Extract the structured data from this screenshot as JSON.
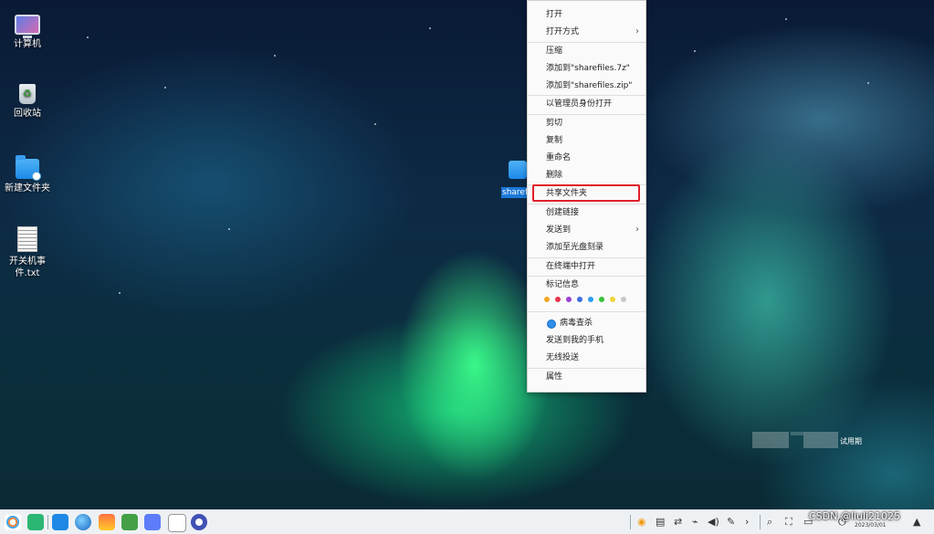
{
  "desktop": {
    "icons": [
      {
        "label": "计算机",
        "icon": "computer-icon"
      },
      {
        "label": "回收站",
        "icon": "trash-icon"
      },
      {
        "label": "新建文件夹",
        "icon": "folder-icon"
      },
      {
        "label": "开关机事件.txt",
        "icon": "text-file-icon"
      }
    ],
    "selected_item": {
      "label": "sharefiles",
      "icon": "folder-icon"
    }
  },
  "context_menu": {
    "items": [
      {
        "label": "打开",
        "submenu": false
      },
      {
        "label": "打开方式",
        "submenu": true
      },
      {
        "label": "压缩",
        "submenu": false
      },
      {
        "label": "添加到\"sharefiles.7z\"",
        "submenu": false
      },
      {
        "label": "添加到\"sharefiles.zip\"",
        "submenu": false
      },
      {
        "label": "以管理员身份打开",
        "submenu": false
      },
      {
        "label": "剪切",
        "submenu": false
      },
      {
        "label": "复制",
        "submenu": false
      },
      {
        "label": "重命名",
        "submenu": false
      },
      {
        "label": "删除",
        "submenu": false
      },
      {
        "label": "共享文件夹",
        "submenu": false,
        "highlighted": true
      },
      {
        "label": "创建链接",
        "submenu": false
      },
      {
        "label": "发送到",
        "submenu": true
      },
      {
        "label": "添加至光盘刻录",
        "submenu": false
      },
      {
        "label": "在终端中打开",
        "submenu": false
      },
      {
        "label": "标记信息",
        "submenu": false
      },
      {
        "label": "病毒查杀",
        "submenu": false,
        "icon": "shield-icon"
      },
      {
        "label": "发送到我的手机",
        "submenu": false
      },
      {
        "label": "无线投送",
        "submenu": false
      },
      {
        "label": "属性",
        "submenu": false
      }
    ],
    "submenu_arrow": "›",
    "tag_colors": [
      "#f5a623",
      "#e8334a",
      "#9b3fd6",
      "#3b6fe0",
      "#2a9df4",
      "#39c239",
      "#f2d43a",
      "#c8c8c8"
    ],
    "highlight_color": "#e0202a"
  },
  "watermark": {
    "text": "试用期"
  },
  "taskbar": {
    "apps": [
      "start-menu-icon",
      "file-manager-icon",
      "app-store-icon",
      "browser-icon",
      "image-viewer-icon",
      "music-icon",
      "document-icon",
      "notes-icon",
      "settings-icon"
    ],
    "tray": [
      "antivirus-icon",
      "keyboard-icon",
      "network-switch-icon",
      "usb-icon",
      "volume-icon",
      "pen-icon",
      "expand-icon",
      "search-icon",
      "screenshot-icon",
      "display-icon",
      "power-icon"
    ],
    "overlay_text": "CSDN @liuli21025",
    "date": "2023/03/01"
  }
}
